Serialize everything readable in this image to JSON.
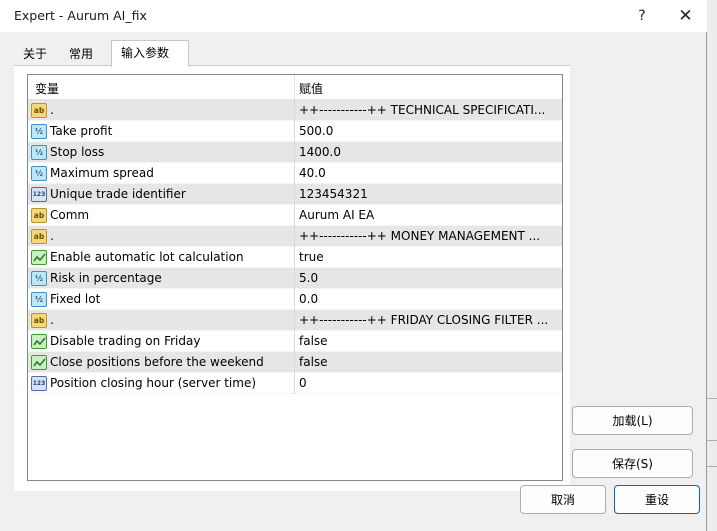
{
  "window": {
    "title": "Expert - Aurum AI_fix",
    "help_label": "?",
    "close_label": "✕"
  },
  "tabs": [
    {
      "label": "关于"
    },
    {
      "label": "常用"
    },
    {
      "label": "输入参数"
    }
  ],
  "grid": {
    "columns": {
      "variable": "变量",
      "value": "赋值"
    },
    "rows": [
      {
        "icon": "string-type-icon",
        "name": ".",
        "value": "++-----------++    TECHNICAL SPECIFICATI..."
      },
      {
        "icon": "double-type-icon",
        "name": "Take profit",
        "value": "500.0"
      },
      {
        "icon": "double-type-icon",
        "name": "Stop loss",
        "value": "1400.0"
      },
      {
        "icon": "double-type-icon",
        "name": "Maximum spread",
        "value": "40.0"
      },
      {
        "icon": "integer-type-icon",
        "name": "Unique trade identifier",
        "value": "123454321"
      },
      {
        "icon": "string-type-icon",
        "name": "Comm",
        "value": "Aurum AI EA"
      },
      {
        "icon": "string-type-icon",
        "name": ".",
        "value": "++-----------++    MONEY MANAGEMENT ..."
      },
      {
        "icon": "bool-type-icon",
        "name": "Enable automatic lot calculation",
        "value": "true"
      },
      {
        "icon": "double-type-icon",
        "name": "Risk in percentage",
        "value": "5.0"
      },
      {
        "icon": "double-type-icon",
        "name": "Fixed lot",
        "value": "0.0"
      },
      {
        "icon": "string-type-icon",
        "name": ".",
        "value": "++-----------++    FRIDAY CLOSING FILTER ..."
      },
      {
        "icon": "bool-type-icon",
        "name": "Disable trading on Friday",
        "value": "false"
      },
      {
        "icon": "bool-type-icon",
        "name": "Close positions before the weekend",
        "value": "false"
      },
      {
        "icon": "integer-type-icon",
        "name": "Position closing hour (server time)",
        "value": "0"
      }
    ]
  },
  "buttons": {
    "load": "加载(L)",
    "save": "保存(S)",
    "cancel": "取消",
    "reset": "重设"
  },
  "icon_glyphs": {
    "string": "ab",
    "double": "½",
    "integer": "123"
  },
  "colors": {
    "accent": "#0067c0",
    "row_alt": "#e6e6e6"
  }
}
